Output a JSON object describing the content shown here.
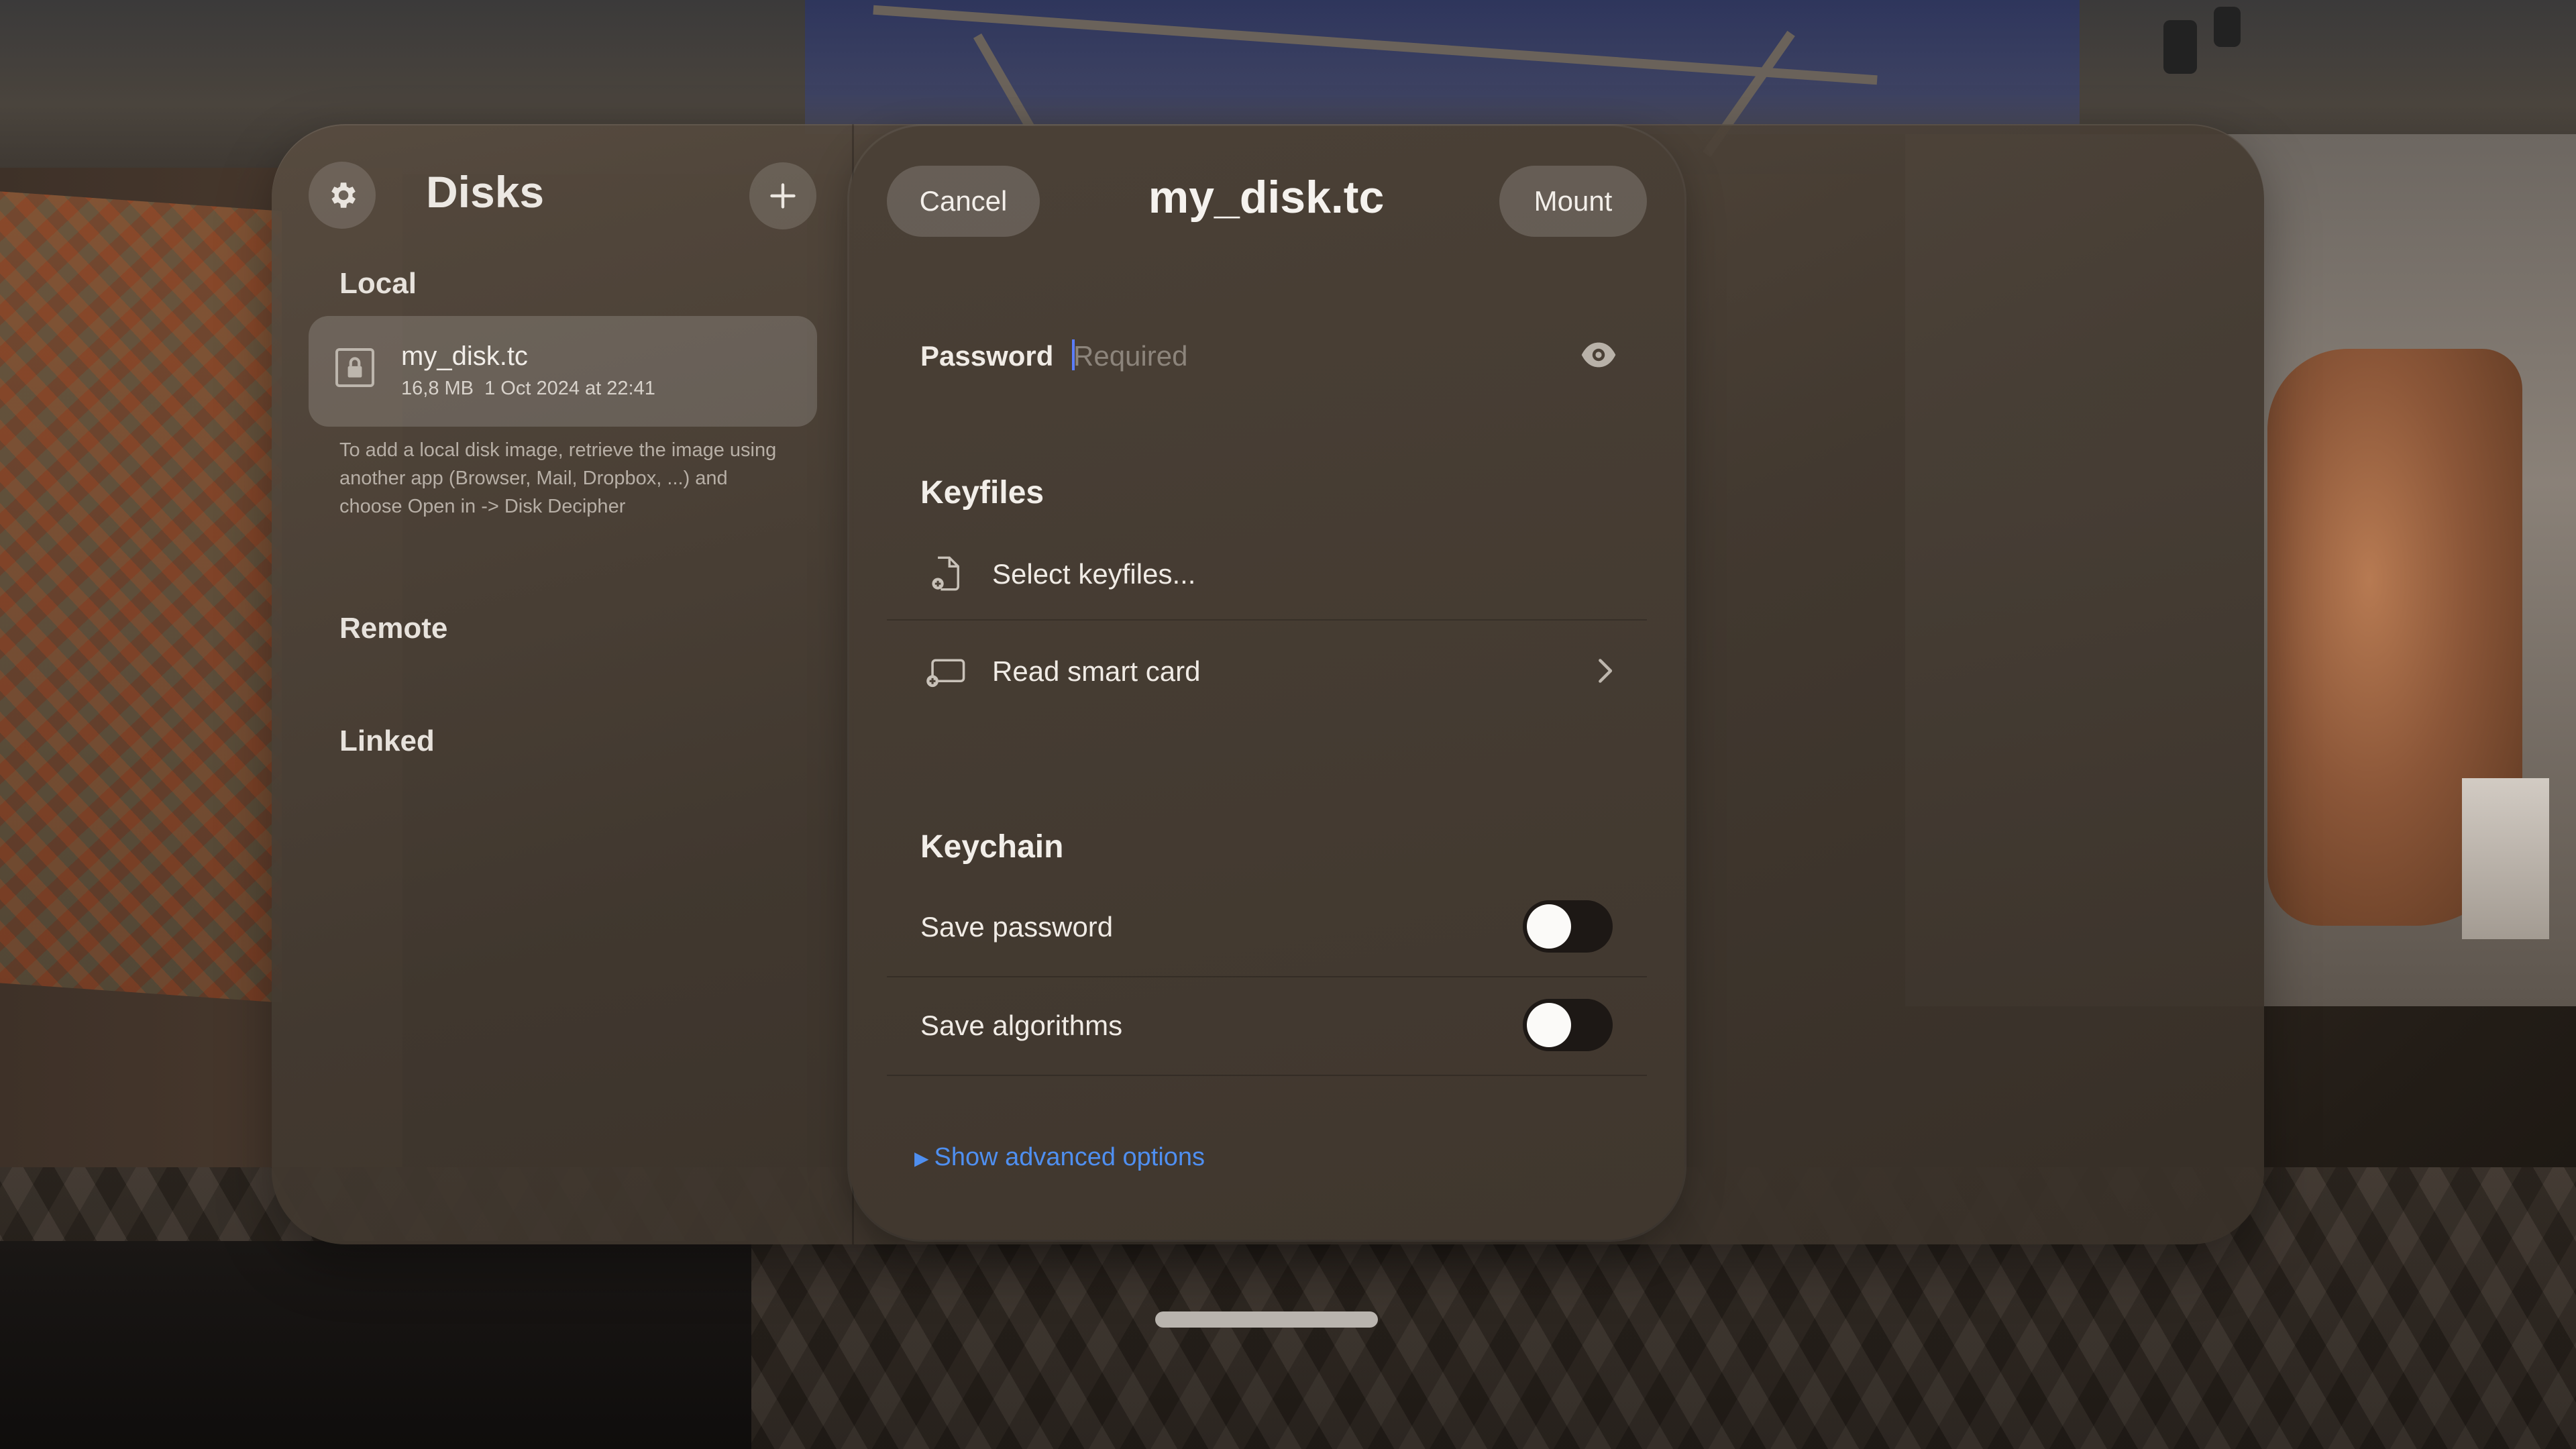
{
  "sidebar": {
    "title": "Disks",
    "settings_icon": "gear-icon",
    "add_icon": "plus-icon",
    "sections": {
      "local": "Local",
      "remote": "Remote",
      "linked": "Linked"
    },
    "disk": {
      "name": "my_disk.tc",
      "size": "16,8 MB",
      "date": "1 Oct 2024 at 22:41",
      "icon": "lock-icon"
    },
    "help_text": "To add a local disk image, retrieve the image using another app (Browser, Mail, Dropbox, ...) and choose Open in -> Disk Decipher"
  },
  "sheet": {
    "title": "my_disk.tc",
    "cancel_label": "Cancel",
    "mount_label": "Mount",
    "password": {
      "label": "Password",
      "placeholder": "Required",
      "value": "",
      "reveal_icon": "eye-icon"
    },
    "keyfiles": {
      "header": "Keyfiles",
      "select_label": "Select keyfiles...",
      "select_icon": "add-document-icon",
      "smartcard_label": "Read smart card",
      "smartcard_icon": "smart-card-icon",
      "chevron_icon": "chevron-right-icon"
    },
    "keychain": {
      "header": "Keychain",
      "save_password_label": "Save password",
      "save_password_on": false,
      "save_algorithms_label": "Save algorithms",
      "save_algorithms_on": false
    },
    "advanced_label": "Show advanced options"
  },
  "colors": {
    "accent_link": "#4f8ff0",
    "caret": "#5b7dff",
    "toggle_off": "#1d1815"
  }
}
